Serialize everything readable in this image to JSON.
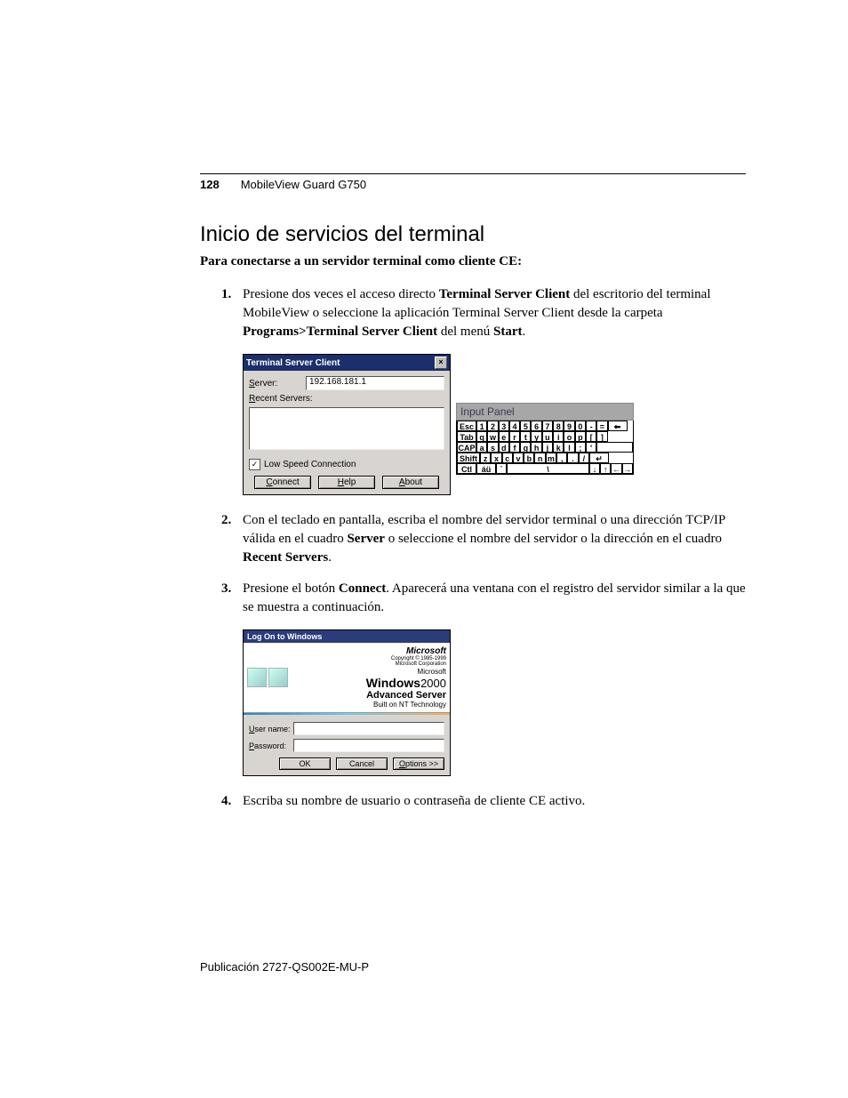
{
  "header": {
    "page_number": "128",
    "doc_title": "MobileView Guard G750"
  },
  "section": {
    "title": "Inicio de servicios del terminal",
    "subtitle": "Para conectarse a un servidor terminal como cliente CE:"
  },
  "steps": {
    "s1": {
      "num": "1.",
      "pre": "Presione dos veces el acceso directo ",
      "b1": "Terminal Server Client",
      "mid": " del escritorio del terminal MobileView o seleccione la aplicación Terminal Server Client desde la carpeta  ",
      "b2": "Programs>Terminal Server Client",
      "mid2": " del menú ",
      "b3": "Start",
      "post": "."
    },
    "s2": {
      "num": "2.",
      "pre": "Con el teclado en pantalla, escriba el nombre del servidor terminal o una dirección TCP/IP válida en el cuadro ",
      "b1": "Server",
      "mid": " o seleccione el nombre del servidor o la dirección en el cuadro ",
      "b2": "Recent Servers",
      "post": "."
    },
    "s3": {
      "num": "3.",
      "pre": "Presione el botón ",
      "b1": "Connect",
      "post": ". Aparecerá una ventana con el registro del servidor similar a la que se muestra a continuación."
    },
    "s4": {
      "num": "4.",
      "text": "Escriba su nombre de usuario o contraseña de cliente CE activo."
    }
  },
  "tsc": {
    "title": "Terminal Server Client",
    "close": "×",
    "server_label_u": "S",
    "server_label_rest": "erver:",
    "server_value": "192.168.181.1",
    "recent_label_u": "R",
    "recent_label_rest": "ecent Servers:",
    "low_speed": "Low Speed Connection",
    "connect_u": "C",
    "connect_rest": "onnect",
    "help_u": "H",
    "help_rest": "elp",
    "about_u": "A",
    "about_rest": "bout"
  },
  "input_panel": {
    "title": "Input Panel",
    "rows": {
      "r1": [
        "Esc",
        "1",
        "2",
        "3",
        "4",
        "5",
        "6",
        "7",
        "8",
        "9",
        "0",
        "-",
        "=",
        "⬅"
      ],
      "r2": [
        "Tab",
        "q",
        "w",
        "e",
        "r",
        "t",
        "y",
        "u",
        "i",
        "o",
        "p",
        "[",
        "]"
      ],
      "r3": [
        "CAP",
        "a",
        "s",
        "d",
        "f",
        "g",
        "h",
        "j",
        "k",
        "l",
        ";",
        "'"
      ],
      "r4": [
        "Shift",
        "z",
        "x",
        "c",
        "v",
        "b",
        "n",
        "m",
        ",",
        ".",
        "/",
        "↵"
      ],
      "r5": [
        "Ctl",
        "áü",
        "`",
        "\\",
        "↓",
        "↑",
        "←",
        "→"
      ]
    }
  },
  "logon": {
    "title": "Log On to Windows",
    "ms": "Microsoft",
    "copyright": "Copyright © 1985-1999\nMicrosoft Corporation",
    "ms_small": "Microsoft",
    "win": "Windows",
    "win_year": "2000",
    "adv": "Advanced Server",
    "built": "Built on NT Technology",
    "user_u": "U",
    "user_rest": "ser name:",
    "pass_u": "P",
    "pass_rest": "assword:",
    "ok": "OK",
    "cancel": "Cancel",
    "options_u": "O",
    "options_rest": "ptions >>"
  },
  "footer": {
    "text": "Publicación 2727-QS002E-MU-P"
  }
}
